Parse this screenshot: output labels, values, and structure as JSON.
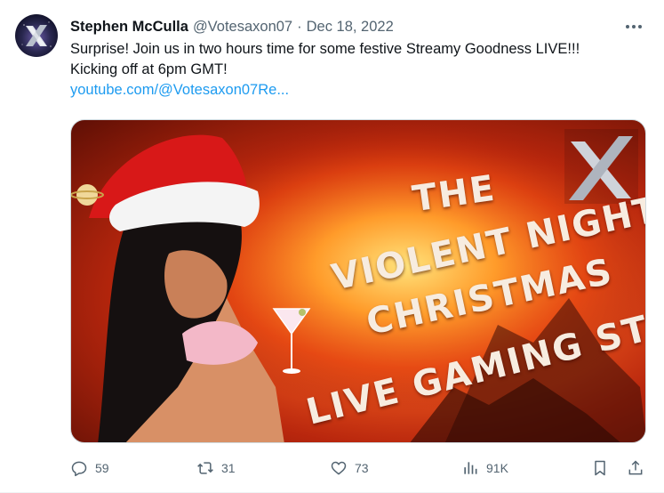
{
  "author": {
    "name": "Stephen McCulla",
    "handle": "@Votesaxon07",
    "separator": "·",
    "date": "Dec 18, 2022",
    "avatar_icon": "x-logo-avatar"
  },
  "more_icon": "more-dots-icon",
  "post": {
    "line1": "Surprise! Join us in two hours time for some festive Streamy Goodness LIVE!!!",
    "line2": "Kicking off at 6pm GMT!",
    "link": "youtube.com/@Votesaxon07Re..."
  },
  "media": {
    "title_lines": [
      "THE",
      "VIOLENT NIGHT",
      "CHRISTMAS",
      "LIVE GAMING STREAM"
    ],
    "logo_letter": "X"
  },
  "actions": {
    "replies": "59",
    "retweets": "31",
    "likes": "73",
    "views": "91K"
  },
  "colors": {
    "link": "#1d9bf0",
    "secondary_text": "#536471",
    "primary_text": "#0f1419"
  }
}
